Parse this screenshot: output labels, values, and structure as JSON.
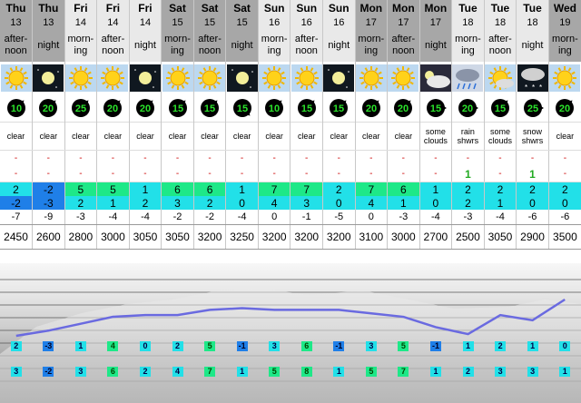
{
  "columns": [
    {
      "day": "Thu",
      "date": "13",
      "period": "after-noon",
      "shade": "shade",
      "sky": "sun",
      "wind_speed": "10",
      "wind_dir": 225,
      "description": "clear",
      "rain": "-",
      "snow": "-",
      "max": "2",
      "max_class": "t-cyan",
      "min": "-2",
      "min_class": "t-blue",
      "chill": "-7",
      "freeze": "2450",
      "lbl_max": "2",
      "lbl_max_class": "c",
      "lbl_min": "3",
      "lbl_min_class": "c"
    },
    {
      "day": "Thu",
      "date": "13",
      "period": "night",
      "shade": "shade",
      "sky": "moon",
      "wind_speed": "20",
      "wind_dir": 225,
      "description": "clear",
      "rain": "-",
      "snow": "-",
      "max": "-2",
      "max_class": "t-blue",
      "min": "-3",
      "min_class": "t-blue",
      "chill": "-9",
      "freeze": "2600",
      "lbl_max": "-3",
      "lbl_max_class": "b",
      "lbl_min": "-2",
      "lbl_min_class": "b"
    },
    {
      "day": "Fri",
      "date": "14",
      "period": "morn-ing",
      "shade": "light",
      "sky": "sun",
      "wind_speed": "25",
      "wind_dir": 225,
      "description": "clear",
      "rain": "-",
      "snow": "-",
      "max": "5",
      "max_class": "t-green",
      "min": "2",
      "min_class": "t-cyan",
      "chill": "-3",
      "freeze": "2800",
      "lbl_max": "1",
      "lbl_max_class": "c",
      "lbl_min": "3",
      "lbl_min_class": "c"
    },
    {
      "day": "Fri",
      "date": "14",
      "period": "after-noon",
      "shade": "light",
      "sky": "sun",
      "wind_speed": "20",
      "wind_dir": 225,
      "description": "clear",
      "rain": "-",
      "snow": "-",
      "max": "5",
      "max_class": "t-green",
      "min": "1",
      "min_class": "t-cyan",
      "chill": "-4",
      "freeze": "3000",
      "lbl_max": "4",
      "lbl_max_class": "g",
      "lbl_min": "6",
      "lbl_min_class": "g"
    },
    {
      "day": "Fri",
      "date": "14",
      "period": "night",
      "shade": "light",
      "sky": "moon",
      "wind_speed": "20",
      "wind_dir": 225,
      "description": "clear",
      "rain": "-",
      "snow": "-",
      "max": "1",
      "max_class": "t-cyan",
      "min": "2",
      "min_class": "t-cyan",
      "chill": "-4",
      "freeze": "3050",
      "lbl_max": "0",
      "lbl_max_class": "c",
      "lbl_min": "2",
      "lbl_min_class": "c"
    },
    {
      "day": "Sat",
      "date": "15",
      "period": "morn-ing",
      "shade": "shade",
      "sky": "sun",
      "wind_speed": "15",
      "wind_dir": 225,
      "description": "clear",
      "rain": "-",
      "snow": "-",
      "max": "6",
      "max_class": "t-green",
      "min": "3",
      "min_class": "t-cyan",
      "chill": "-2",
      "freeze": "3050",
      "lbl_max": "2",
      "lbl_max_class": "c",
      "lbl_min": "4",
      "lbl_min_class": "c"
    },
    {
      "day": "Sat",
      "date": "15",
      "period": "after-noon",
      "shade": "shade",
      "sky": "sun",
      "wind_speed": "15",
      "wind_dir": 225,
      "description": "clear",
      "rain": "-",
      "snow": "-",
      "max": "6",
      "max_class": "t-green",
      "min": "2",
      "min_class": "t-cyan",
      "chill": "-2",
      "freeze": "3200",
      "lbl_max": "5",
      "lbl_max_class": "g",
      "lbl_min": "7",
      "lbl_min_class": "g"
    },
    {
      "day": "Sat",
      "date": "15",
      "period": "night",
      "shade": "shade",
      "sky": "moon",
      "wind_speed": "15",
      "wind_dir": 315,
      "description": "clear",
      "rain": "-",
      "snow": "-",
      "max": "1",
      "max_class": "t-cyan",
      "min": "0",
      "min_class": "t-cyan",
      "chill": "-4",
      "freeze": "3250",
      "lbl_max": "-1",
      "lbl_max_class": "b",
      "lbl_min": "1",
      "lbl_min_class": "c"
    },
    {
      "day": "Sun",
      "date": "16",
      "period": "morn-ing",
      "shade": "light",
      "sky": "sun",
      "wind_speed": "10",
      "wind_dir": 225,
      "description": "clear",
      "rain": "-",
      "snow": "-",
      "max": "7",
      "max_class": "t-green",
      "min": "4",
      "min_class": "t-cyan",
      "chill": "0",
      "freeze": "3200",
      "lbl_max": "3",
      "lbl_max_class": "c",
      "lbl_min": "5",
      "lbl_min_class": "g"
    },
    {
      "day": "Sun",
      "date": "16",
      "period": "after-noon",
      "shade": "light",
      "sky": "sun",
      "wind_speed": "15",
      "wind_dir": 225,
      "description": "clear",
      "rain": "-",
      "snow": "-",
      "max": "7",
      "max_class": "t-green",
      "min": "3",
      "min_class": "t-cyan",
      "chill": "-1",
      "freeze": "3200",
      "lbl_max": "6",
      "lbl_max_class": "g",
      "lbl_min": "8",
      "lbl_min_class": "g"
    },
    {
      "day": "Sun",
      "date": "16",
      "period": "night",
      "shade": "light",
      "sky": "moon",
      "wind_speed": "15",
      "wind_dir": 225,
      "description": "clear",
      "rain": "-",
      "snow": "-",
      "max": "2",
      "max_class": "t-cyan",
      "min": "0",
      "min_class": "t-cyan",
      "chill": "-5",
      "freeze": "3200",
      "lbl_max": "-1",
      "lbl_max_class": "b",
      "lbl_min": "1",
      "lbl_min_class": "c"
    },
    {
      "day": "Mon",
      "date": "17",
      "period": "morn-ing",
      "shade": "shade",
      "sky": "sun",
      "wind_speed": "20",
      "wind_dir": 225,
      "description": "clear",
      "rain": "-",
      "snow": "-",
      "max": "7",
      "max_class": "t-green",
      "min": "4",
      "min_class": "t-cyan",
      "chill": "0",
      "freeze": "3100",
      "lbl_max": "3",
      "lbl_max_class": "c",
      "lbl_min": "5",
      "lbl_min_class": "g"
    },
    {
      "day": "Mon",
      "date": "17",
      "period": "after-noon",
      "shade": "shade",
      "sky": "sun",
      "wind_speed": "20",
      "wind_dir": 225,
      "description": "clear",
      "rain": "-",
      "snow": "-",
      "max": "6",
      "max_class": "t-green",
      "min": "1",
      "min_class": "t-cyan",
      "chill": "-3",
      "freeze": "3000",
      "lbl_max": "5",
      "lbl_max_class": "g",
      "lbl_min": "7",
      "lbl_min_class": "g"
    },
    {
      "day": "Mon",
      "date": "17",
      "period": "night",
      "shade": "shade",
      "sky": "cloud",
      "wind_speed": "15",
      "wind_dir": 270,
      "description": "some clouds",
      "rain": "-",
      "snow": "-",
      "max": "1",
      "max_class": "t-cyan",
      "min": "0",
      "min_class": "t-cyan",
      "chill": "-4",
      "freeze": "2700",
      "lbl_max": "-1",
      "lbl_max_class": "b",
      "lbl_min": "1",
      "lbl_min_class": "c"
    },
    {
      "day": "Tue",
      "date": "18",
      "period": "morn-ing",
      "shade": "light",
      "sky": "rain",
      "wind_speed": "20",
      "wind_dir": 270,
      "description": "rain shwrs",
      "rain": "-",
      "snow": "1",
      "snow_green": true,
      "max": "2",
      "max_class": "t-cyan",
      "min": "2",
      "min_class": "t-cyan",
      "chill": "-3",
      "freeze": "2500",
      "lbl_max": "1",
      "lbl_max_class": "c",
      "lbl_min": "2",
      "lbl_min_class": "c"
    },
    {
      "day": "Tue",
      "date": "18",
      "period": "after-noon",
      "shade": "light",
      "sky": "sunmoon",
      "wind_speed": "15",
      "wind_dir": 225,
      "description": "some clouds",
      "rain": "-",
      "snow": "-",
      "max": "2",
      "max_class": "t-cyan",
      "min": "1",
      "min_class": "t-cyan",
      "chill": "-4",
      "freeze": "3050",
      "lbl_max": "2",
      "lbl_max_class": "c",
      "lbl_min": "3",
      "lbl_min_class": "c"
    },
    {
      "day": "Tue",
      "date": "18",
      "period": "night",
      "shade": "light",
      "sky": "snow",
      "wind_speed": "25",
      "wind_dir": 270,
      "description": "snow shwrs",
      "rain": "-",
      "snow": "1",
      "snow_green": true,
      "max": "2",
      "max_class": "t-cyan",
      "min": "0",
      "min_class": "t-cyan",
      "chill": "-6",
      "freeze": "2900",
      "lbl_max": "1",
      "lbl_max_class": "c",
      "lbl_min": "3",
      "lbl_min_class": "c"
    },
    {
      "day": "Wed",
      "date": "19",
      "period": "morn-ing",
      "shade": "shade",
      "sky": "sun",
      "wind_speed": "20",
      "wind_dir": 225,
      "description": "clear",
      "rain": "-",
      "snow": "-",
      "max": "2",
      "max_class": "t-cyan",
      "min": "0",
      "min_class": "t-cyan",
      "chill": "-6",
      "freeze": "3500",
      "lbl_max": "0",
      "lbl_max_class": "c",
      "lbl_min": "1",
      "lbl_min_class": "c"
    }
  ],
  "freezing_level_line": [
    2450,
    2600,
    2800,
    3000,
    3050,
    3050,
    3200,
    3250,
    3200,
    3200,
    3200,
    3100,
    3000,
    2700,
    2500,
    3050,
    2900,
    3500
  ],
  "colors": {
    "shade": "#a7a7a7",
    "light": "#e9e9e9",
    "cold_blue": "#1f7fe8",
    "cyan": "#22e0e8",
    "green": "#1ee888",
    "line": "#6a6ae0"
  }
}
